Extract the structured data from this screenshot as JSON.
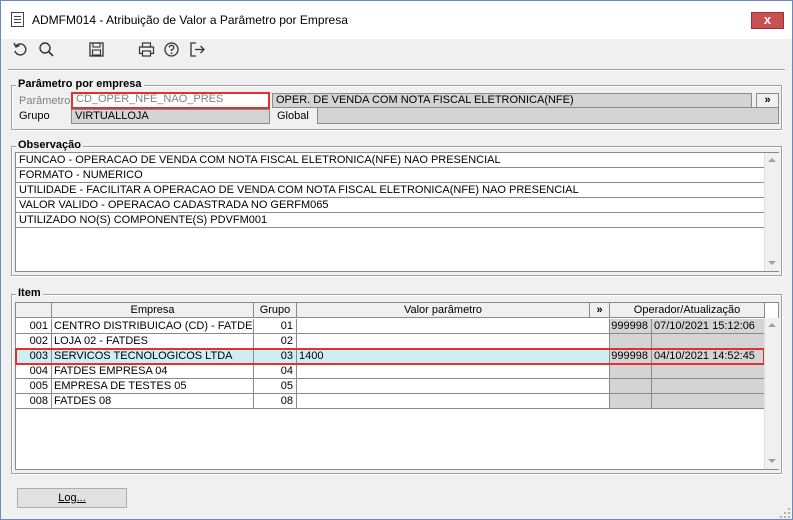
{
  "window": {
    "title": "ADMFM014 - Atribuição de Valor a Parâmetro por Empresa",
    "close_glyph": "x"
  },
  "toolbar": {
    "icons": [
      "undo-icon",
      "search-icon",
      "save-icon",
      "print-icon",
      "help-icon",
      "exit-icon"
    ]
  },
  "parametro_empresa": {
    "group_label": "Parâmetro por empresa",
    "parametro_label": "Parâmetro",
    "parametro_value": "CD_OPER_NFE_NAO_PRES",
    "parametro_desc": "OPER. DE VENDA COM NOTA FISCAL ELETRONICA(NFE)",
    "expand_label": "»",
    "grupo_label": "Grupo",
    "grupo_value": "VIRTUALLOJA",
    "global_label": "Global",
    "global_value": ""
  },
  "observacao": {
    "group_label": "Observação",
    "lines": [
      "FUNCAO - OPERACAO DE VENDA COM NOTA FISCAL ELETRONICA(NFE) NAO PRESENCIAL",
      "FORMATO - NUMERICO",
      "UTILIDADE - FACILITAR A OPERACAO DE VENDA COM NOTA FISCAL ELETRONICA(NFE) NAO PRESENCIAL",
      "VALOR VALIDO - OPERACAO CADASTRADA NO GERFM065",
      "UTILIZADO NO(S) COMPONENTE(S) PDVFM001"
    ]
  },
  "item": {
    "group_label": "Item",
    "headers": {
      "empresa": "Empresa",
      "grupo": "Grupo",
      "valor": "Valor parâmetro",
      "expand": "»",
      "operador": "Operador/Atualização"
    },
    "rows": [
      {
        "code": "001",
        "empresa": "CENTRO DISTRIBUICAO (CD) - FATDES",
        "grupo": "01",
        "valor": "",
        "operador": "999998",
        "data": "07/10/2021 15:12:06"
      },
      {
        "code": "002",
        "empresa": "LOJA 02 - FATDES",
        "grupo": "02",
        "valor": "",
        "operador": "",
        "data": ""
      },
      {
        "code": "003",
        "empresa": "SERVICOS TECNOLOGICOS LTDA",
        "grupo": "03",
        "valor": "1400",
        "operador": "999998",
        "data": "04/10/2021 14:52:45"
      },
      {
        "code": "004",
        "empresa": "FATDES EMPRESA 04",
        "grupo": "04",
        "valor": "",
        "operador": "",
        "data": ""
      },
      {
        "code": "005",
        "empresa": "EMPRESA DE TESTES 05",
        "grupo": "05",
        "valor": "",
        "operador": "",
        "data": ""
      },
      {
        "code": "008",
        "empresa": "FATDES 08",
        "grupo": "08",
        "valor": "",
        "operador": "",
        "data": ""
      }
    ]
  },
  "footer": {
    "log_label": "Log..."
  }
}
